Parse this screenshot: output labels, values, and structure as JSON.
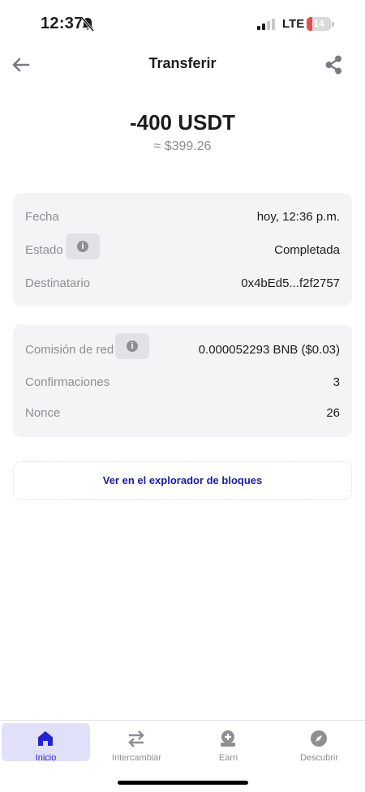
{
  "status_bar": {
    "time": "12:37",
    "network": "LTE",
    "battery": "14"
  },
  "header": {
    "title": "Transferir"
  },
  "amount": {
    "value": "-400 USDT",
    "fiat": "≈ $399.26"
  },
  "details": [
    {
      "label": "Fecha",
      "value": "hoy, 12:36 p.m."
    },
    {
      "label": "Estado",
      "value": "Completada"
    },
    {
      "label": "Destinatario",
      "value": "0x4bEd5...f2f2757"
    }
  ],
  "fees": [
    {
      "label": "Comisión de red",
      "value": "0.000052293 BNB ($0.03)"
    },
    {
      "label": "Confirmaciones",
      "value": "3"
    },
    {
      "label": "Nonce",
      "value": "26"
    }
  ],
  "explorer_link": "Ver en el explorador de bloques",
  "nav": [
    {
      "label": "Inicio",
      "icon": "home-icon",
      "active": true
    },
    {
      "label": "Intercambiar",
      "icon": "swap-icon",
      "active": false
    },
    {
      "label": "Earn",
      "icon": "earn-icon",
      "active": false
    },
    {
      "label": "Descubrir",
      "icon": "compass-icon",
      "active": false
    }
  ],
  "colors": {
    "accent": "#2323d6",
    "link": "#1a1aa6",
    "card_bg": "#f4f4f6",
    "muted": "#8e8e93",
    "battery_low": "#e54d4d"
  }
}
